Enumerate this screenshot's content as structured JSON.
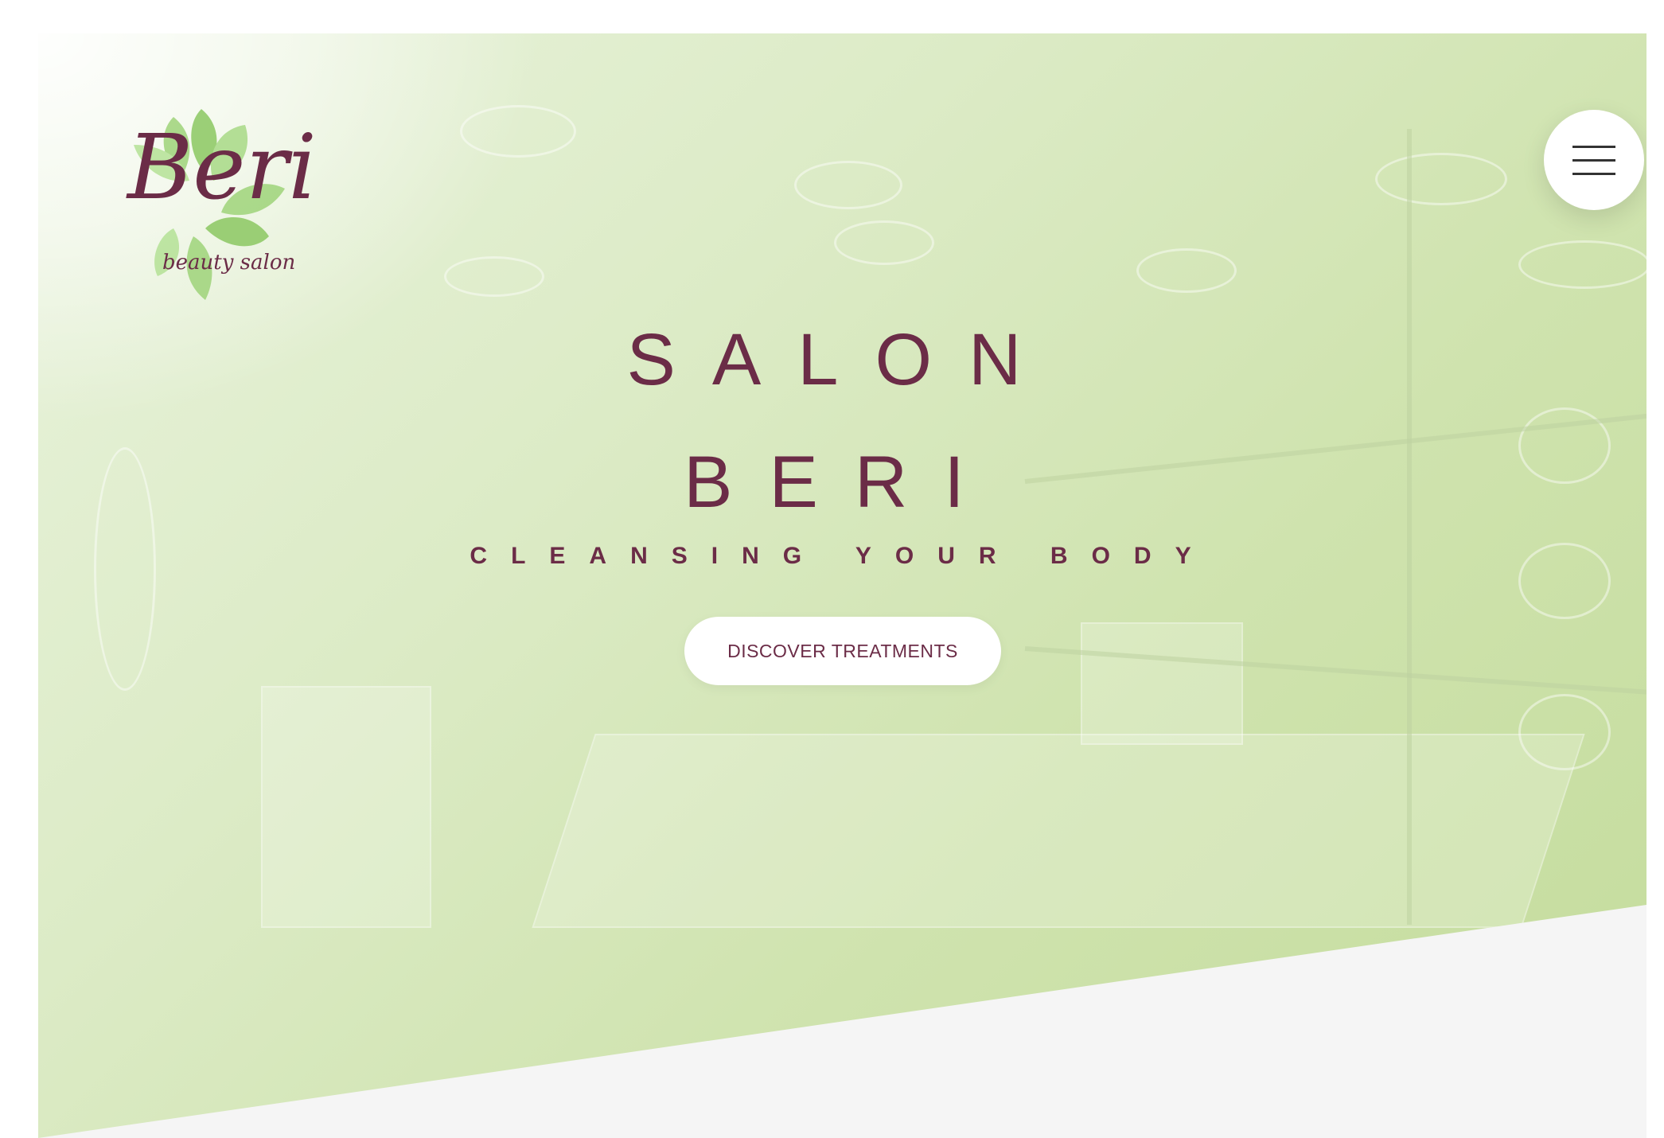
{
  "brand": {
    "logo_script": "Beri",
    "logo_tagline": "beauty salon"
  },
  "hero": {
    "title_line_1": "SALON",
    "title_line_2": "BERI",
    "subtitle": "CLEANSING YOUR BODY",
    "cta_label": "DISCOVER TREATMENTS"
  },
  "colors": {
    "accent": "#6b2c47",
    "hero_green": "#cfe3ae",
    "leaf_green": "#8cc862",
    "section_bg": "#f5f5f5"
  },
  "icons": {
    "menu": "hamburger-menu-icon",
    "logo": "leaf-logo"
  }
}
